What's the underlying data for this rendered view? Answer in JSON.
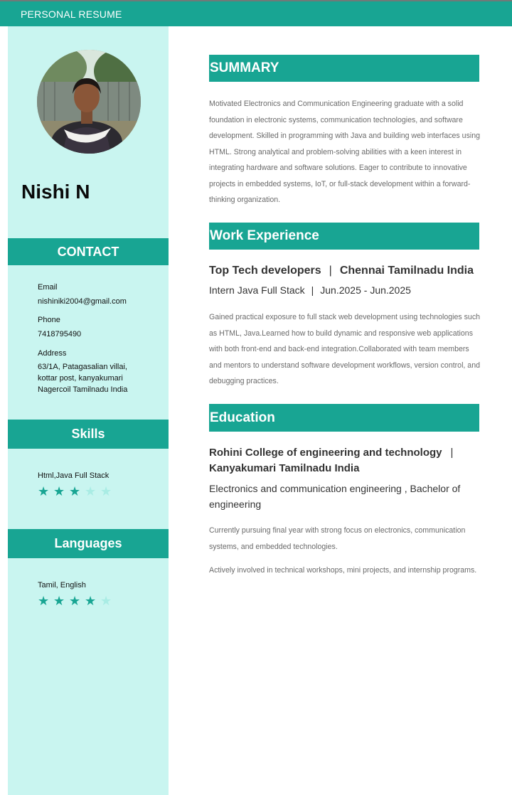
{
  "header": {
    "title": "PERSONAL RESUME"
  },
  "profile": {
    "name": "Nishi N"
  },
  "contact": {
    "heading": "CONTACT",
    "email_label": "Email",
    "email": "nishiniki2004@gmail.com",
    "phone_label": "Phone",
    "phone": "7418795490",
    "address_label": "Address",
    "address_lines": [
      "63/1A, Patagasalian villai,",
      "kottar post, kanyakumari",
      "Nagercoil Tamilnadu India"
    ]
  },
  "skills": {
    "heading": "Skills",
    "items": [
      {
        "name": "Html,Java Full Stack",
        "rating": 3,
        "max": 5
      }
    ]
  },
  "languages": {
    "heading": "Languages",
    "items": [
      {
        "name": "Tamil, English",
        "rating": 4,
        "max": 5
      }
    ]
  },
  "summary": {
    "heading": "SUMMARY",
    "text": "Motivated Electronics and Communication Engineering graduate with a solid foundation in electronic systems, communication technologies, and software development. Skilled in programming with Java and building web interfaces using HTML. Strong analytical and problem-solving abilities with a keen interest in integrating hardware and software solutions. Eager to contribute to innovative projects in embedded systems, IoT, or full-stack development within a forward-thinking organization."
  },
  "work": {
    "heading": "Work Experience",
    "company": "Top Tech developers",
    "separator": "|",
    "location": "Chennai Tamilnadu India",
    "role": "Intern Java Full Stack",
    "dates": "Jun.2025 - Jun.2025",
    "description": "Gained practical exposure to full stack web development using technologies such as HTML, Java.Learned how to build dynamic and responsive web applications with both front-end and back-end integration.Collaborated with team members and mentors to understand software development workflows, version control, and debugging practices."
  },
  "education": {
    "heading": "Education",
    "institution": "Rohini College of engineering and technology",
    "separator": "|",
    "location": "Kanyakumari Tamilnadu India",
    "degree": "Electronics and communication engineering , Bachelor of engineering",
    "details": [
      "Currently pursuing final year with strong focus on electronics, communication systems, and embedded technologies.",
      "Actively involved in technical workshops, mini projects, and internship programs."
    ]
  },
  "colors": {
    "accent": "#18a593",
    "sidebar_bg": "#c9f5f0",
    "star_off": "#a9ece4"
  }
}
